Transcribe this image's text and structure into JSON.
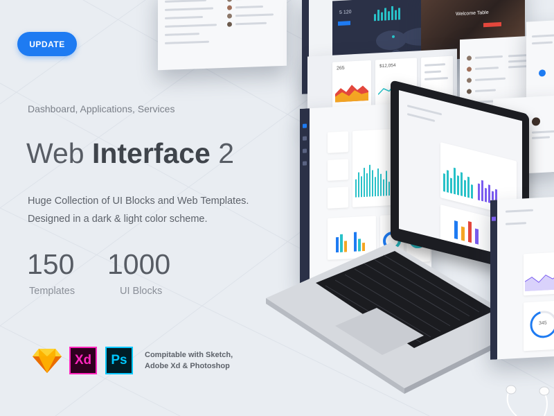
{
  "update_button": {
    "label": "UPDATE"
  },
  "hero": {
    "subtitle": "Dashboard, Applications, Services",
    "title_light": "Web ",
    "title_bold": "Interface",
    "title_num": " 2",
    "description_line1": "Huge Collection of UI Blocks and Web Templates.",
    "description_line2": "Designed in a dark & light  color scheme."
  },
  "stats": [
    {
      "value": "150",
      "label": "Templates"
    },
    {
      "value": "1000",
      "label": "UI Blocks"
    }
  ],
  "apps": [
    {
      "name": "Sketch",
      "icon": "sketch-diamond-icon",
      "color": "#f7b500"
    },
    {
      "name": "Xd",
      "icon": "adobe-xd-icon",
      "color": "#ff26be"
    },
    {
      "name": "Ps",
      "icon": "photoshop-icon",
      "color": "#00c8ff"
    }
  ],
  "compatibility": {
    "line1": "Compitable with Sketch,",
    "line2": "Adobe Xd & Photoshop"
  },
  "mockup": {
    "dark_panel_stats": [
      "5 120",
      "265"
    ],
    "price_label": "$12,054",
    "header_text": "Welcome Table",
    "chart_label": "345",
    "colors": {
      "accent_blue": "#1e7bf2",
      "dark_navy": "#2b3147",
      "teal": "#28c1c8",
      "orange": "#f5a623",
      "red": "#e3473c",
      "purple": "#7a5cf0"
    }
  }
}
